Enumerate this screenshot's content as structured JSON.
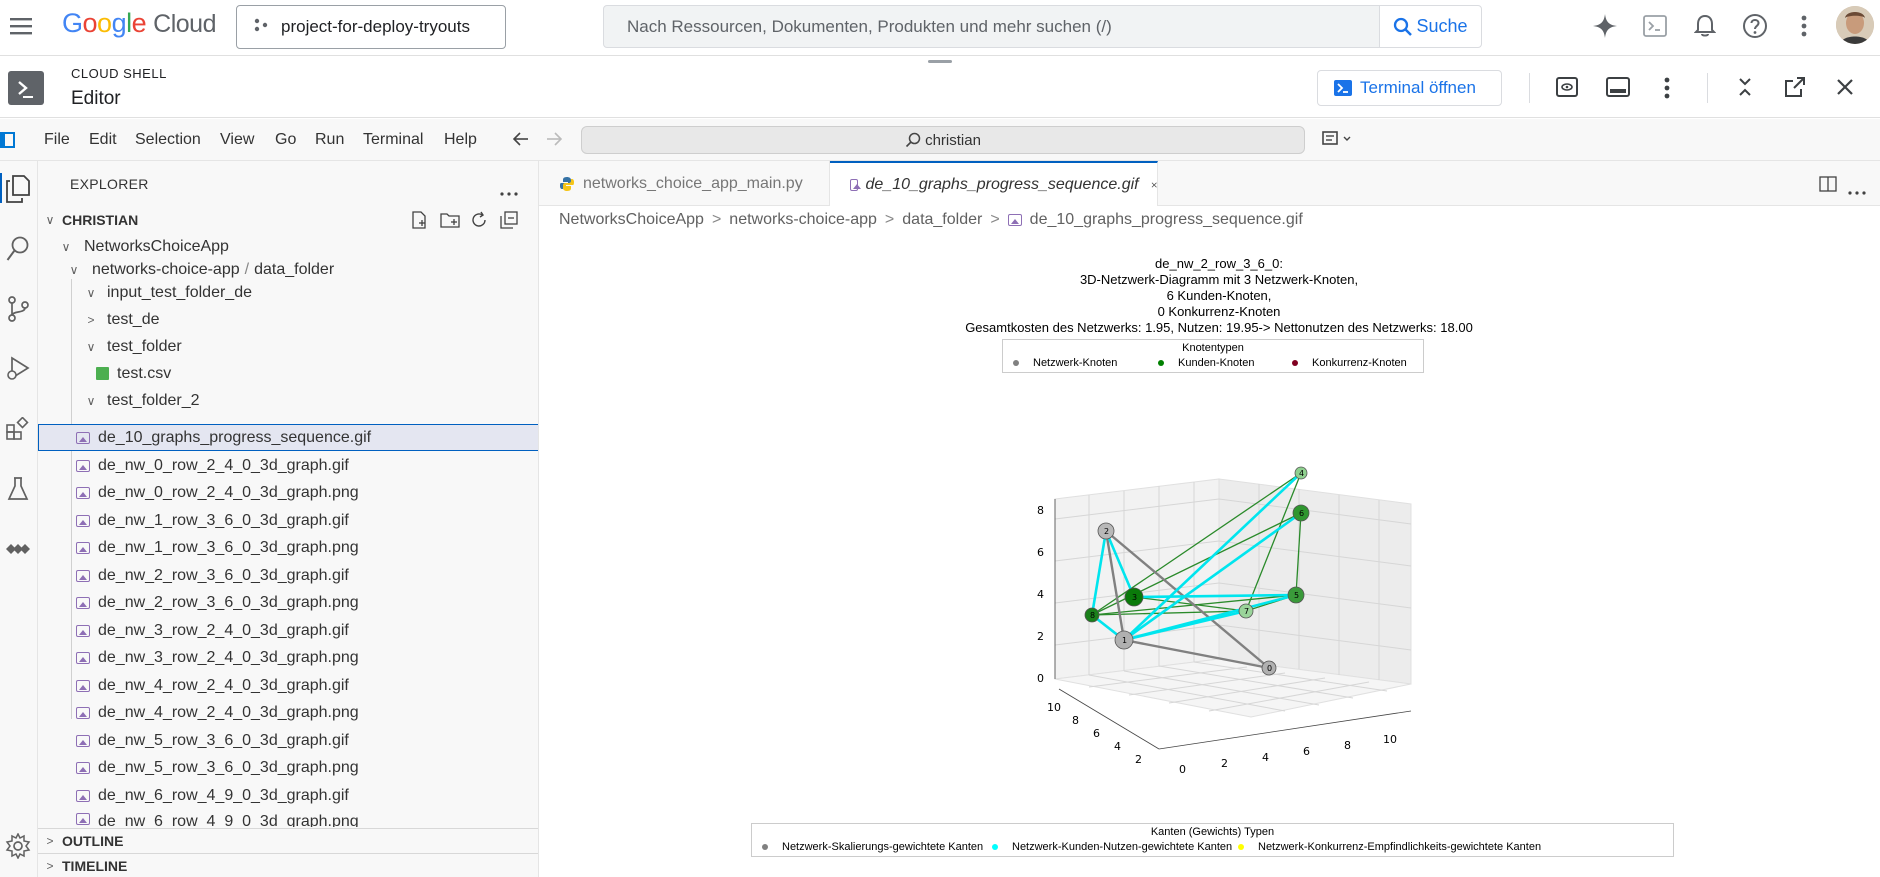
{
  "topbar": {
    "logo_google": "Google",
    "logo_cloud": "Cloud",
    "project": "project-for-deploy-tryouts",
    "search_placeholder": "Nach Ressourcen, Dokumenten, Produkten und mehr suchen (/)",
    "search_button": "Suche"
  },
  "shell": {
    "label": "CLOUD SHELL",
    "title": "Editor",
    "terminal_button": "Terminal öffnen"
  },
  "menu": {
    "items": [
      "File",
      "Edit",
      "Selection",
      "View",
      "Go",
      "Run",
      "Terminal",
      "Help"
    ],
    "command_center": "christian"
  },
  "explorer": {
    "title": "EXPLORER",
    "root": "CHRISTIAN",
    "tree": [
      "NetworksChoiceApp",
      "networks-choice-app",
      "data_folder",
      "input_test_folder_de",
      "test_de",
      "test_folder",
      "test.csv",
      "test_folder_2",
      "de_10_graphs_progress_sequence.gif",
      "de_nw_0_row_2_4_0_3d_graph.gif",
      "de_nw_0_row_2_4_0_3d_graph.png",
      "de_nw_1_row_3_6_0_3d_graph.gif",
      "de_nw_1_row_3_6_0_3d_graph.png",
      "de_nw_2_row_3_6_0_3d_graph.gif",
      "de_nw_2_row_3_6_0_3d_graph.png",
      "de_nw_3_row_2_4_0_3d_graph.gif",
      "de_nw_3_row_2_4_0_3d_graph.png",
      "de_nw_4_row_2_4_0_3d_graph.gif",
      "de_nw_4_row_2_4_0_3d_graph.png",
      "de_nw_5_row_3_6_0_3d_graph.gif",
      "de_nw_5_row_3_6_0_3d_graph.png",
      "de_nw_6_row_4_9_0_3d_graph.gif",
      "de_nw_6_row_4_9_0_3d_graph.png"
    ],
    "outline": "OUTLINE",
    "timeline": "TIMELINE"
  },
  "editor": {
    "tab1": "networks_choice_app_main.py",
    "tab2": "de_10_graphs_progress_sequence.gif",
    "breadcrumb": [
      "NetworksChoiceApp",
      "networks-choice-app",
      "data_folder",
      "de_10_graphs_progress_sequence.gif"
    ]
  },
  "plot": {
    "title_lines": [
      "de_nw_2_row_3_6_0:",
      "3D-Netzwerk-Diagramm mit 3 Netzwerk-Knoten,",
      "6 Kunden-Knoten,",
      "0 Konkurrenz-Knoten",
      "Gesamtkosten des Netzwerks: 1.95, Nutzen: 19.95-> Nettonutzen des Netzwerks: 18.00"
    ],
    "node_legend_title": "Knotentypen",
    "node_legend": [
      {
        "label": "Netzwerk-Knoten",
        "color": "#808080"
      },
      {
        "label": "Kunden-Knoten",
        "color": "#008000"
      },
      {
        "label": "Konkurrenz-Knoten",
        "color": "#800020"
      }
    ],
    "edge_legend_title": "Kanten (Gewichts) Typen",
    "edge_legend": [
      {
        "label": "Netzwerk-Skalierungs-gewichtete Kanten",
        "color": "#808080"
      },
      {
        "label": "Netzwerk-Kunden-Nutzen-gewichtete Kanten",
        "color": "#00ffff"
      },
      {
        "label": "Netzwerk-Konkurrenz-Empfindlichkeits-gewichtete Kanten",
        "color": "#ffff00"
      }
    ],
    "z_ticks": [
      "0",
      "2",
      "4",
      "6",
      "8"
    ],
    "x_ticks": [
      "0",
      "2",
      "4",
      "6",
      "8",
      "10"
    ],
    "y_ticks": [
      "2",
      "4",
      "6",
      "8",
      "10"
    ],
    "node_labels": [
      "0",
      "1",
      "2",
      "3",
      "4",
      "5",
      "6",
      "7",
      "8"
    ]
  }
}
